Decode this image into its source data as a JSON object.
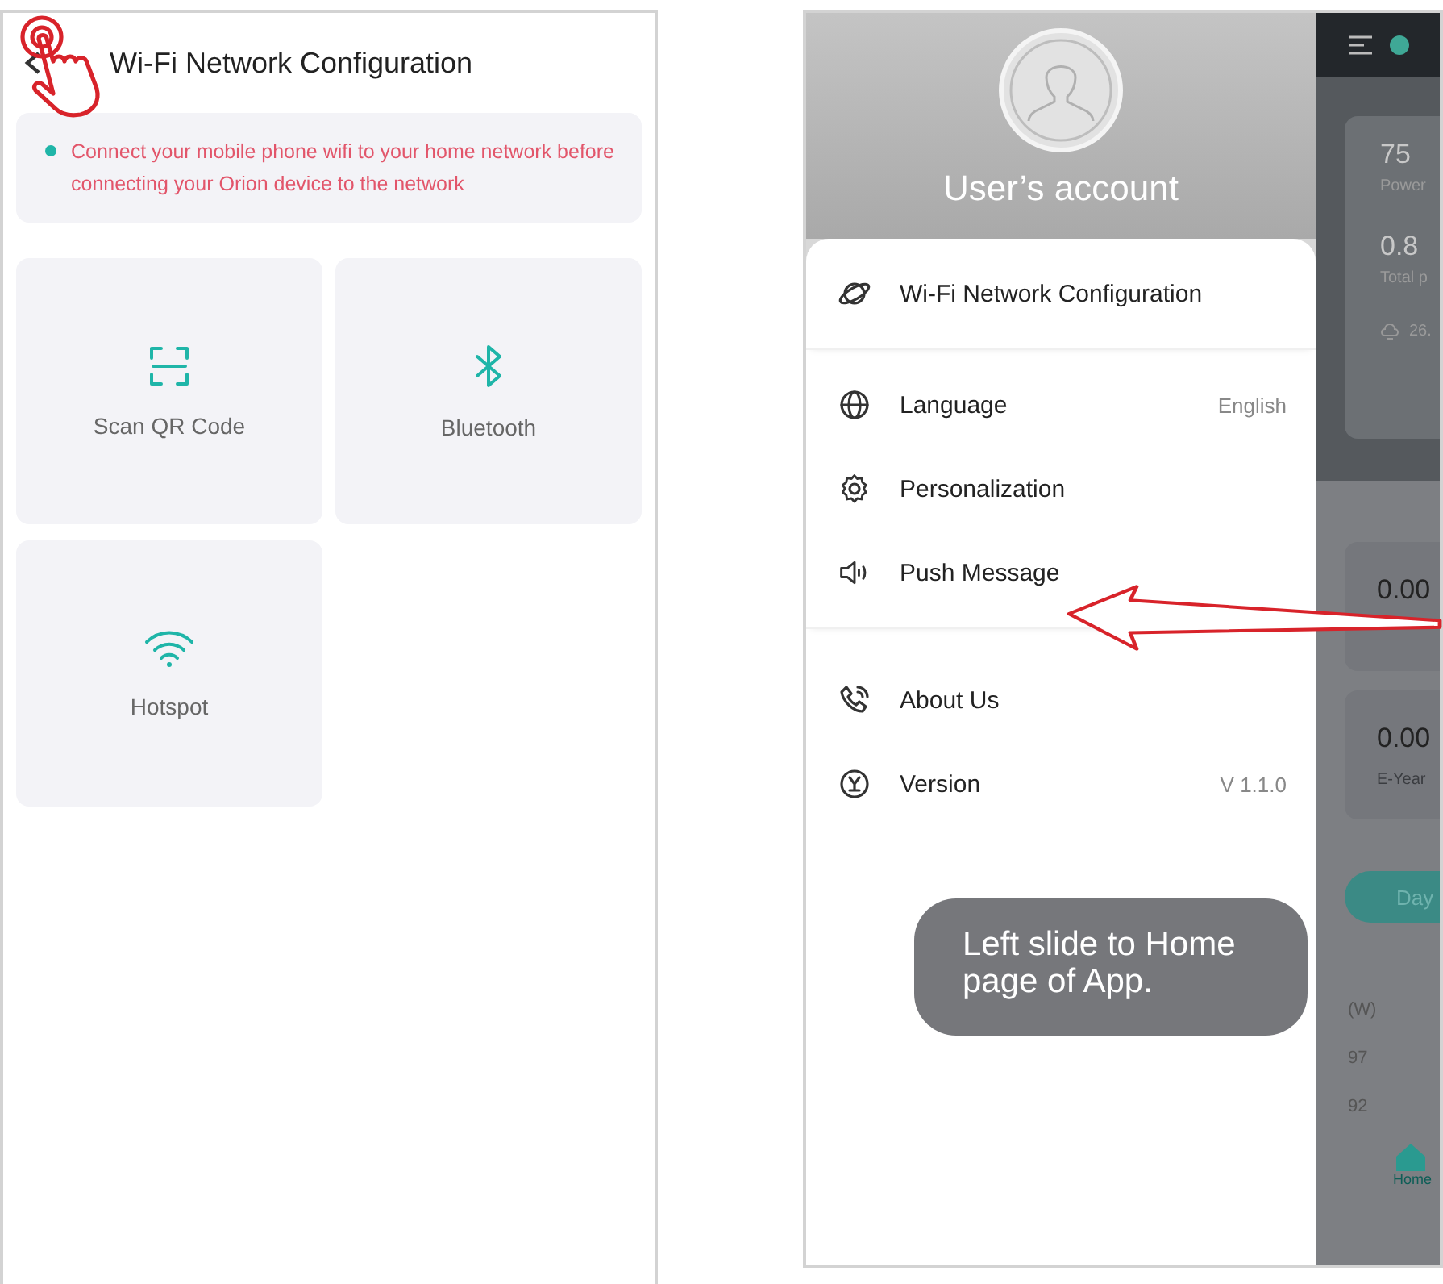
{
  "config_screen": {
    "title": "Wi-Fi Network Configuration",
    "notice": "Connect your mobile phone wifi to your home network before connecting your Orion device to the network",
    "options": [
      {
        "kind": "qr",
        "label": "Scan QR Code"
      },
      {
        "kind": "bluetooth",
        "label": "Bluetooth"
      },
      {
        "kind": "wifi",
        "label": "Hotspot"
      }
    ]
  },
  "drawer": {
    "account": "User’s account",
    "sections": [
      [
        {
          "kind": "planet",
          "label": "Wi-Fi Network Configuration"
        }
      ],
      [
        {
          "kind": "globe",
          "label": "Language",
          "value": "English"
        },
        {
          "kind": "gear",
          "label": "Personalization"
        },
        {
          "kind": "speaker",
          "label": "Push Message"
        }
      ],
      [
        {
          "kind": "phone",
          "label": "About Us"
        },
        {
          "kind": "version",
          "label": "Version",
          "value": "V 1.1.0"
        }
      ]
    ]
  },
  "home_screen": {
    "stats": [
      {
        "value": "75",
        "label": "Power"
      },
      {
        "value": "0.8",
        "label": "Total p"
      }
    ],
    "weather": "26.",
    "energy": [
      {
        "value": "0.00"
      },
      {
        "value": "0.00",
        "label": "E-Year"
      }
    ],
    "tab": "Day",
    "chart_unit": "(W)",
    "y_ticks": [
      "97",
      "92"
    ],
    "nav": "Home"
  },
  "callout": "Left slide to Home page of App."
}
